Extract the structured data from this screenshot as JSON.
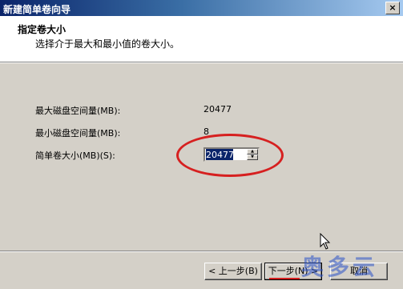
{
  "window": {
    "title": "新建简单卷向导",
    "close_label": "×"
  },
  "header": {
    "title": "指定卷大小",
    "subtitle": "选择介于最大和最小值的卷大小。"
  },
  "fields": {
    "max_label": "最大磁盘空间量(MB):",
    "max_value": "20477",
    "min_label": "最小磁盘空间量(MB):",
    "min_value": "8",
    "size_label": "简单卷大小(MB)(S):",
    "size_value": "20477"
  },
  "buttons": {
    "back": "< 上一步(B)",
    "next": "下一步(N) >",
    "cancel": "取消"
  },
  "watermark": "奥多云",
  "colors": {
    "annotation": "#d62020",
    "selection": "#0a246a",
    "title_gradient_start": "#0a246a"
  }
}
